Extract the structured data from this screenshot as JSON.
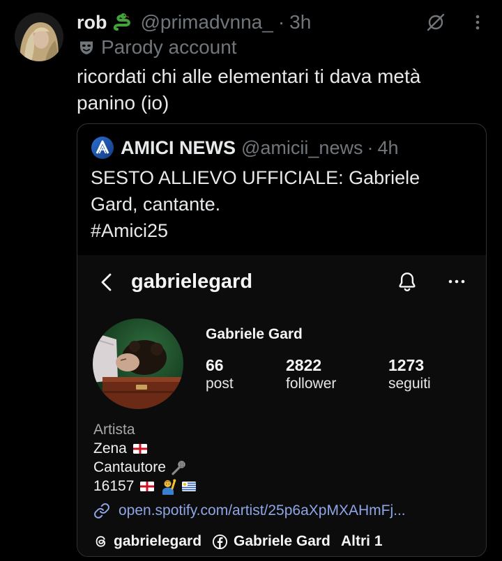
{
  "post": {
    "display_name": "rob",
    "name_emoji_icon": "snake-icon",
    "handle": "@primadvnna_",
    "separator": "·",
    "time": "3h",
    "label_icon": "theater-masks-icon",
    "label": "Parody account",
    "text_lines": [
      "ricordati chi alle elementari ti dava metà",
      "panino (io)"
    ],
    "actions": {
      "grok_icon": "grok-icon",
      "more_icon": "more-vertical-icon"
    }
  },
  "quote": {
    "account_icon": "amici-logo-icon",
    "account_name": "AMICI NEWS",
    "handle": "@amicii_news",
    "separator": "·",
    "time": "4h",
    "text_lines": [
      "SESTO ALLIEVO UFFICIALE: Gabriele",
      "Gard, cantante.",
      "#Amici25"
    ],
    "media": {
      "username": "gabrielegard",
      "full_name": "Gabriele Gard",
      "stats": [
        {
          "value": "66",
          "label": "post"
        },
        {
          "value": "2822",
          "label": "follower"
        },
        {
          "value": "1273",
          "label": "seguiti"
        }
      ],
      "category": "Artista",
      "bio_lines": [
        {
          "text": "Zena",
          "icons": [
            "england-flag-icon"
          ]
        },
        {
          "text": "Cantautore",
          "icons": [
            "microphone-icon"
          ]
        },
        {
          "text": "16157",
          "icons": [
            "england-flag-icon",
            "person-raising-hand-icon",
            "uruguay-flag-icon"
          ]
        }
      ],
      "link_icon": "link-chain-icon",
      "link": "open.spotify.com/artist/25p6aXpMXAHmFj...",
      "links_row": [
        {
          "icon": "threads-icon",
          "label": "gabrielegard"
        },
        {
          "icon": "facebook-icon",
          "label": "Gabriele Gard"
        },
        {
          "label": "Altri 1"
        }
      ]
    }
  },
  "colors": {
    "background": "#000000",
    "text": "#e7e9ea",
    "muted": "#71767b",
    "border": "#2f3336",
    "media_background": "#0c0c0d",
    "link": "#8ea6e5"
  }
}
